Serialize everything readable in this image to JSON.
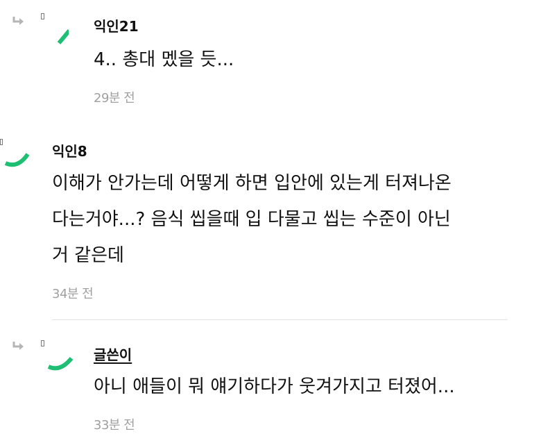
{
  "comments": [
    {
      "author": "익인21",
      "is_reply": true,
      "lines": [
        "4.. 총대 멨을 듯..."
      ],
      "time": "29분 전"
    },
    {
      "author": "익인8",
      "is_reply": false,
      "lines": [
        "이해가 안가는데 어떻게 하면 입안에 있는게 터져나온",
        "다는거야...? 음식 씹을때 입 다물고 씹는 수준이 아닌",
        "거 같은데"
      ],
      "time": "34분 전"
    },
    {
      "author": "글쓴이",
      "is_reply": true,
      "lines": [
        "아니 애들이 뭐 얘기하다가 웃겨가지고 터졌어..."
      ],
      "time": "33분 전"
    }
  ],
  "icons": {
    "reply": "reply-arrow-icon",
    "avatar": "avatar-icon"
  },
  "colors": {
    "avatar_accent": "#1fbf73",
    "reply_arrow": "#b5b5b5",
    "time_text": "#a0a0a0",
    "divider": "#e2e2e2"
  }
}
